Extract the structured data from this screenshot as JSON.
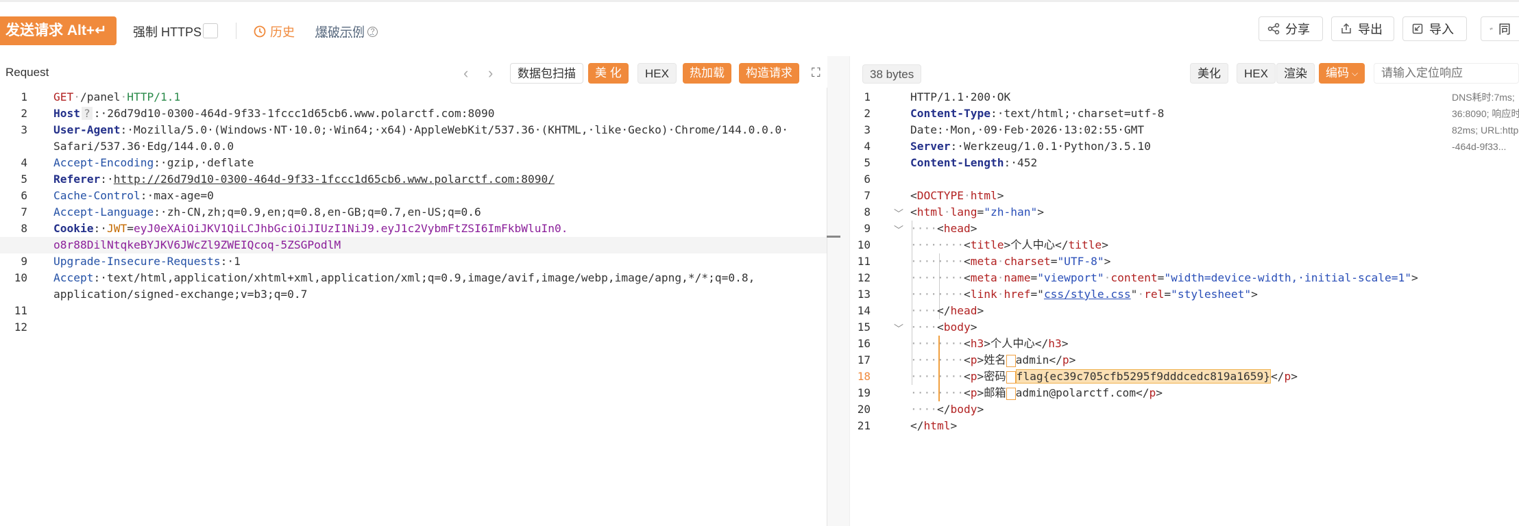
{
  "toolbar": {
    "send_label": "发送请求 Alt+↵",
    "https_label": "强制 HTTPS",
    "history_label": "历史",
    "burst_label": "爆破示例",
    "share_label": "分享",
    "export_label": "导出",
    "import_label": "导入",
    "cut_label": "同"
  },
  "request": {
    "title": "Request",
    "scan_label": "数据包扫描",
    "beautify_label": "美 化",
    "hex_label": "HEX",
    "hotload_label": "热加载",
    "build_label": "构造请求"
  },
  "response": {
    "bytes": "38 bytes",
    "beautify_label": "美化",
    "hex_label": "HEX",
    "render_label": "渲染",
    "encode_label": "编码",
    "search_placeholder": "请输入定位响应",
    "dns_info": [
      "DNS耗时:7ms;",
      "36:8090; 响应时",
      "82ms; URL:http",
      "-464d-9f33..."
    ]
  },
  "request_lines": [
    {
      "n": "1",
      "method": "GET",
      "path": "/panel",
      "proto": "HTTP/1.1"
    },
    {
      "n": "2",
      "key": "Host",
      "val": "26d79d10-0300-464d-9f33-1fccc1d65cb6.www.polarctf.com:8090"
    },
    {
      "n": "3",
      "key": "User-Agent",
      "val": "Mozilla/5.0·(Windows·NT·10.0;·Win64;·x64)·AppleWebKit/537.36·(KHTML,·like·Gecko)·Chrome/144.0.0.0·",
      "cont": "Safari/537.36·Edg/144.0.0.0"
    },
    {
      "n": "4",
      "key": "Accept-Encoding",
      "val": "gzip,·deflate"
    },
    {
      "n": "5",
      "key": "Referer",
      "val": "http://26d79d10-0300-464d-9f33-1fccc1d65cb6.www.polarctf.com:8090/"
    },
    {
      "n": "6",
      "key": "Cache-Control",
      "val": "max-age=0"
    },
    {
      "n": "7",
      "key": "Accept-Language",
      "val": "zh-CN,zh;q=0.9,en;q=0.8,en-GB;q=0.7,en-US;q=0.6"
    },
    {
      "n": "8",
      "key": "Cookie",
      "ck": "JWT",
      "val": "eyJ0eXAiOiJKV1QiLCJhbGciOiJIUzI1NiJ9.eyJ1c2VybmFtZSI6ImFkbWluIn0.",
      "cont": "o8r88DilNtqkeBYJKV6JWcZl9ZWEIQcoq-5ZSGPodlM"
    },
    {
      "n": "9",
      "key": "Upgrade-Insecure-Requests",
      "val": "1"
    },
    {
      "n": "10",
      "key": "Accept",
      "val": "text/html,application/xhtml+xml,application/xml;q=0.9,image/avif,image/webp,image/apng,*/*;q=0.8,",
      "cont": "application/signed-exchange;v=b3;q=0.7"
    },
    {
      "n": "11"
    },
    {
      "n": "12"
    }
  ],
  "response_lines": {
    "l1": "HTTP/1.1·200·OK",
    "l2k": "Content-Type",
    "l2v": "text/html;·charset=utf-8",
    "l3k": "Date",
    "l3v": "Mon,·09·Feb·2026·13:02:55·GMT",
    "l4k": "Server",
    "l4v": "Werkzeug/1.0.1·Python/3.5.10",
    "l5k": "Content-Length",
    "l5v": "452",
    "doctype": "DOCTYPE",
    "doctype_html": "html",
    "html_tag": "html",
    "lang_attr": "lang",
    "lang_val": "\"zh-han\"",
    "head": "head",
    "title_text": "个人中心",
    "meta_charset": "\"UTF-8\"",
    "viewport_name": "\"viewport\"",
    "viewport_content": "\"width=device-width,·initial-scale=1\"",
    "css_href": "css/style.css",
    "rel_val": "\"stylesheet\"",
    "h3_text": "个人中心",
    "user_label": "姓名",
    "user_val": "admin",
    "pass_label": "密码",
    "flag_val": "flag{ec39c705cfb5295f9dddcedc819a1659}",
    "mail_label": "邮箱",
    "mail_val": "admin@polarctf.com"
  },
  "colors": {
    "accent": "#f08a3c"
  }
}
